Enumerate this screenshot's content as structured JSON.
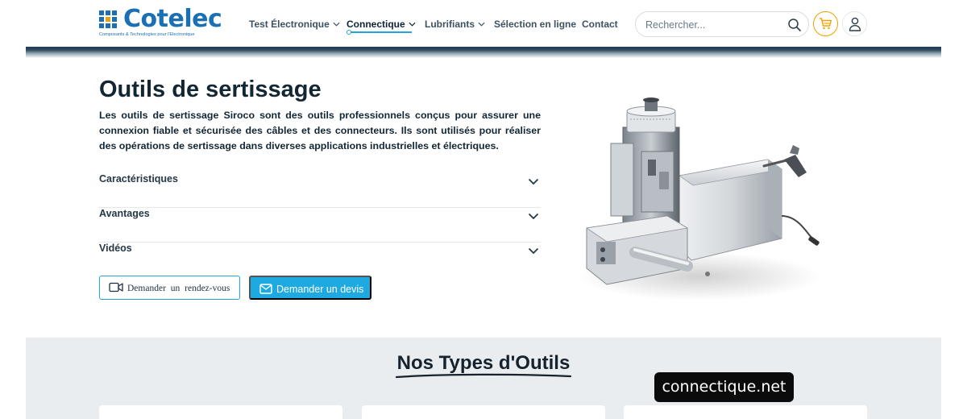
{
  "header": {
    "logo_name": "Cotelec",
    "logo_tagline": "Composants & Technologies pour l'Electronique",
    "nav": [
      {
        "label": "Test Électronique",
        "has_dropdown": true,
        "active": false
      },
      {
        "label": "Connectique",
        "has_dropdown": true,
        "active": true
      },
      {
        "label": "Lubrifiants",
        "has_dropdown": true,
        "active": false
      },
      {
        "label": "Sélection en ligne",
        "has_dropdown": false,
        "active": false
      },
      {
        "label": "Contact",
        "has_dropdown": false,
        "active": false
      }
    ],
    "search": {
      "placeholder": "Rechercher...",
      "value": ""
    },
    "icons": {
      "search": "search-icon",
      "cart": "cart-icon",
      "user": "user-icon"
    }
  },
  "hero": {
    "title": "Outils de sertissage",
    "description": "Les outils de sertissage Siroco sont des outils professionnels conçus pour assurer une connexion fiable et sécurisée des câbles et des connecteurs. Ils sont utilisés pour réaliser des opérations de sertissage dans diverses applications industrielles et électriques.",
    "accordion": [
      {
        "label": "Caractéristiques",
        "expanded": false
      },
      {
        "label": "Avantages",
        "expanded": false
      },
      {
        "label": "Vidéos",
        "expanded": false
      }
    ],
    "buttons": {
      "appointment": "Demander un rendez-vous",
      "quote": "Demander un devis"
    },
    "image_subject": "crimping machine"
  },
  "types": {
    "title": "Nos Types d'Outils",
    "card_count": 3
  },
  "watermark": "connectique.net",
  "colors": {
    "brand_blue": "#1b6fb5",
    "accent_cyan": "#1fa9e1",
    "cart_orange": "#f0a000",
    "dark_text": "#132634",
    "section_bg": "#e9edf0"
  }
}
